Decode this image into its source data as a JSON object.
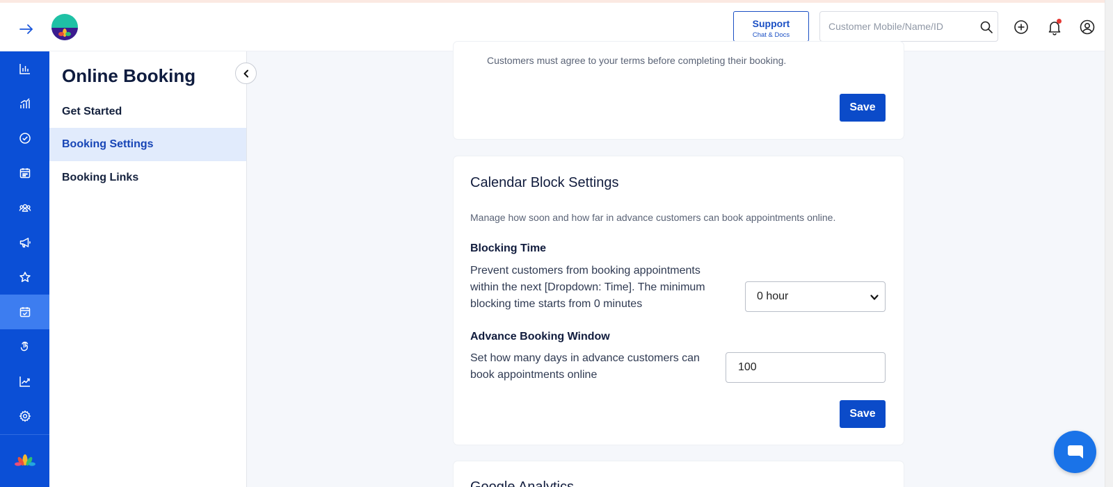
{
  "header": {
    "support_title": "Support",
    "support_subtitle": "Chat & Docs",
    "search_placeholder": "Customer Mobile/Name/ID"
  },
  "sidebar_panel": {
    "title": "Online Booking",
    "items": [
      {
        "label": "Get Started",
        "active": false
      },
      {
        "label": "Booking Settings",
        "active": true
      },
      {
        "label": "Booking Links",
        "active": false
      }
    ]
  },
  "icon_nav": [
    "analytics-icon",
    "reports-icon",
    "check-circle-icon",
    "calendar-icon",
    "customers-icon",
    "megaphone-icon",
    "star-icon",
    "calendar-check-icon",
    "touch-icon",
    "trend-icon",
    "gear-icon"
  ],
  "terms_card": {
    "text": "Customers must agree to your terms before completing their booking.",
    "save_label": "Save"
  },
  "calendar_block": {
    "title": "Calendar Block Settings",
    "description": "Manage how soon and how far in advance customers can book appointments online.",
    "blocking_time_title": "Blocking Time",
    "blocking_time_desc": "Prevent customers from booking appointments within the next [Dropdown: Time]. The minimum blocking time starts from 0 minutes",
    "blocking_time_value": "0 hour",
    "advance_window_title": "Advance Booking Window",
    "advance_window_desc": "Set how many days in advance customers can book appointments online",
    "advance_window_value": "100",
    "save_label": "Save"
  },
  "next_card": {
    "title": "Google Analytics"
  },
  "colors": {
    "primary": "#0b4bc9",
    "nav_bg": "#0b4fd6",
    "nav_active": "#3d7df0",
    "side_active_bg": "#e1ebfc",
    "chat_fab": "#1a73e8"
  }
}
